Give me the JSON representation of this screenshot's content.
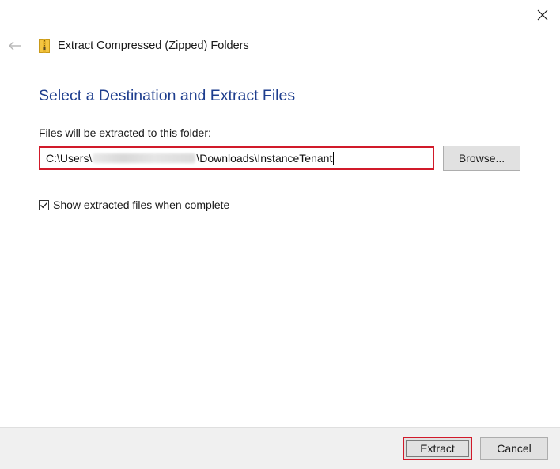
{
  "window": {
    "title": "Extract Compressed (Zipped) Folders",
    "close_icon": "close-icon",
    "back_icon": "back-arrow-icon",
    "folder_icon": "zip-folder-icon"
  },
  "main": {
    "heading": "Select a Destination and Extract Files",
    "field_label": "Files will be extracted to this folder:",
    "path_prefix": "C:\\Users\\",
    "path_suffix": "\\Downloads\\InstanceTenant",
    "browse_label": "Browse...",
    "show_files_label": "Show extracted files when complete",
    "show_files_checked": true
  },
  "footer": {
    "extract_label": "Extract",
    "cancel_label": "Cancel"
  },
  "colors": {
    "heading": "#1e3e8e",
    "highlight": "#d11a2a",
    "button_bg": "#e1e1e1",
    "footer_bg": "#f0f0f0"
  }
}
